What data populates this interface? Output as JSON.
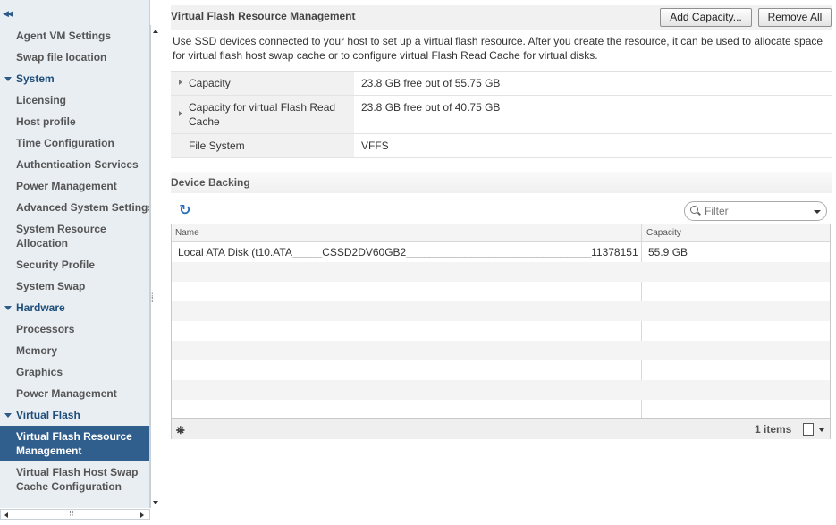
{
  "sidebar": {
    "items": [
      {
        "label": "Agent VM Settings"
      },
      {
        "label": "Swap file location"
      },
      {
        "label": "System"
      },
      {
        "label": "Licensing"
      },
      {
        "label": "Host profile"
      },
      {
        "label": "Time Configuration"
      },
      {
        "label": "Authentication Services"
      },
      {
        "label": "Power Management"
      },
      {
        "label": "Advanced System Settings"
      },
      {
        "label": "System Resource Allocation"
      },
      {
        "label": "Security Profile"
      },
      {
        "label": "System Swap"
      },
      {
        "label": "Hardware"
      },
      {
        "label": "Processors"
      },
      {
        "label": "Memory"
      },
      {
        "label": "Graphics"
      },
      {
        "label": "Power Management"
      },
      {
        "label": "Virtual Flash"
      },
      {
        "label": "Virtual Flash Resource Management"
      },
      {
        "label": "Virtual Flash Host Swap Cache Configuration"
      }
    ]
  },
  "header": {
    "title": "Virtual Flash Resource Management",
    "add_capacity": "Add Capacity...",
    "remove_all": "Remove All"
  },
  "description": "Use SSD devices connected to your host to set up a virtual flash resource. After you create the resource, it can be used to allocate space for virtual flash host swap cache or to configure virtual Flash Read Cache for virtual disks.",
  "properties": [
    {
      "key": "Capacity",
      "value": "23.8 GB free out of 55.75 GB"
    },
    {
      "key": "Capacity for virtual Flash Read Cache",
      "value": "23.8 GB free out of 40.75 GB"
    },
    {
      "key": "File System",
      "value": "VFFS"
    }
  ],
  "device_backing": {
    "title": "Device Backing",
    "filter_placeholder": "Filter",
    "columns": {
      "name": "Name",
      "capacity": "Capacity"
    },
    "rows": [
      {
        "name": "Local ATA Disk (t10.ATA_____CSSD2DV60GB2_______________________________11378151...",
        "capacity": "55.9 GB"
      }
    ],
    "item_count": "1 items"
  },
  "colors": {
    "accent": "#315f8d",
    "group_text": "#1f4e7a",
    "sidebar_bg": "#e9eef3"
  }
}
